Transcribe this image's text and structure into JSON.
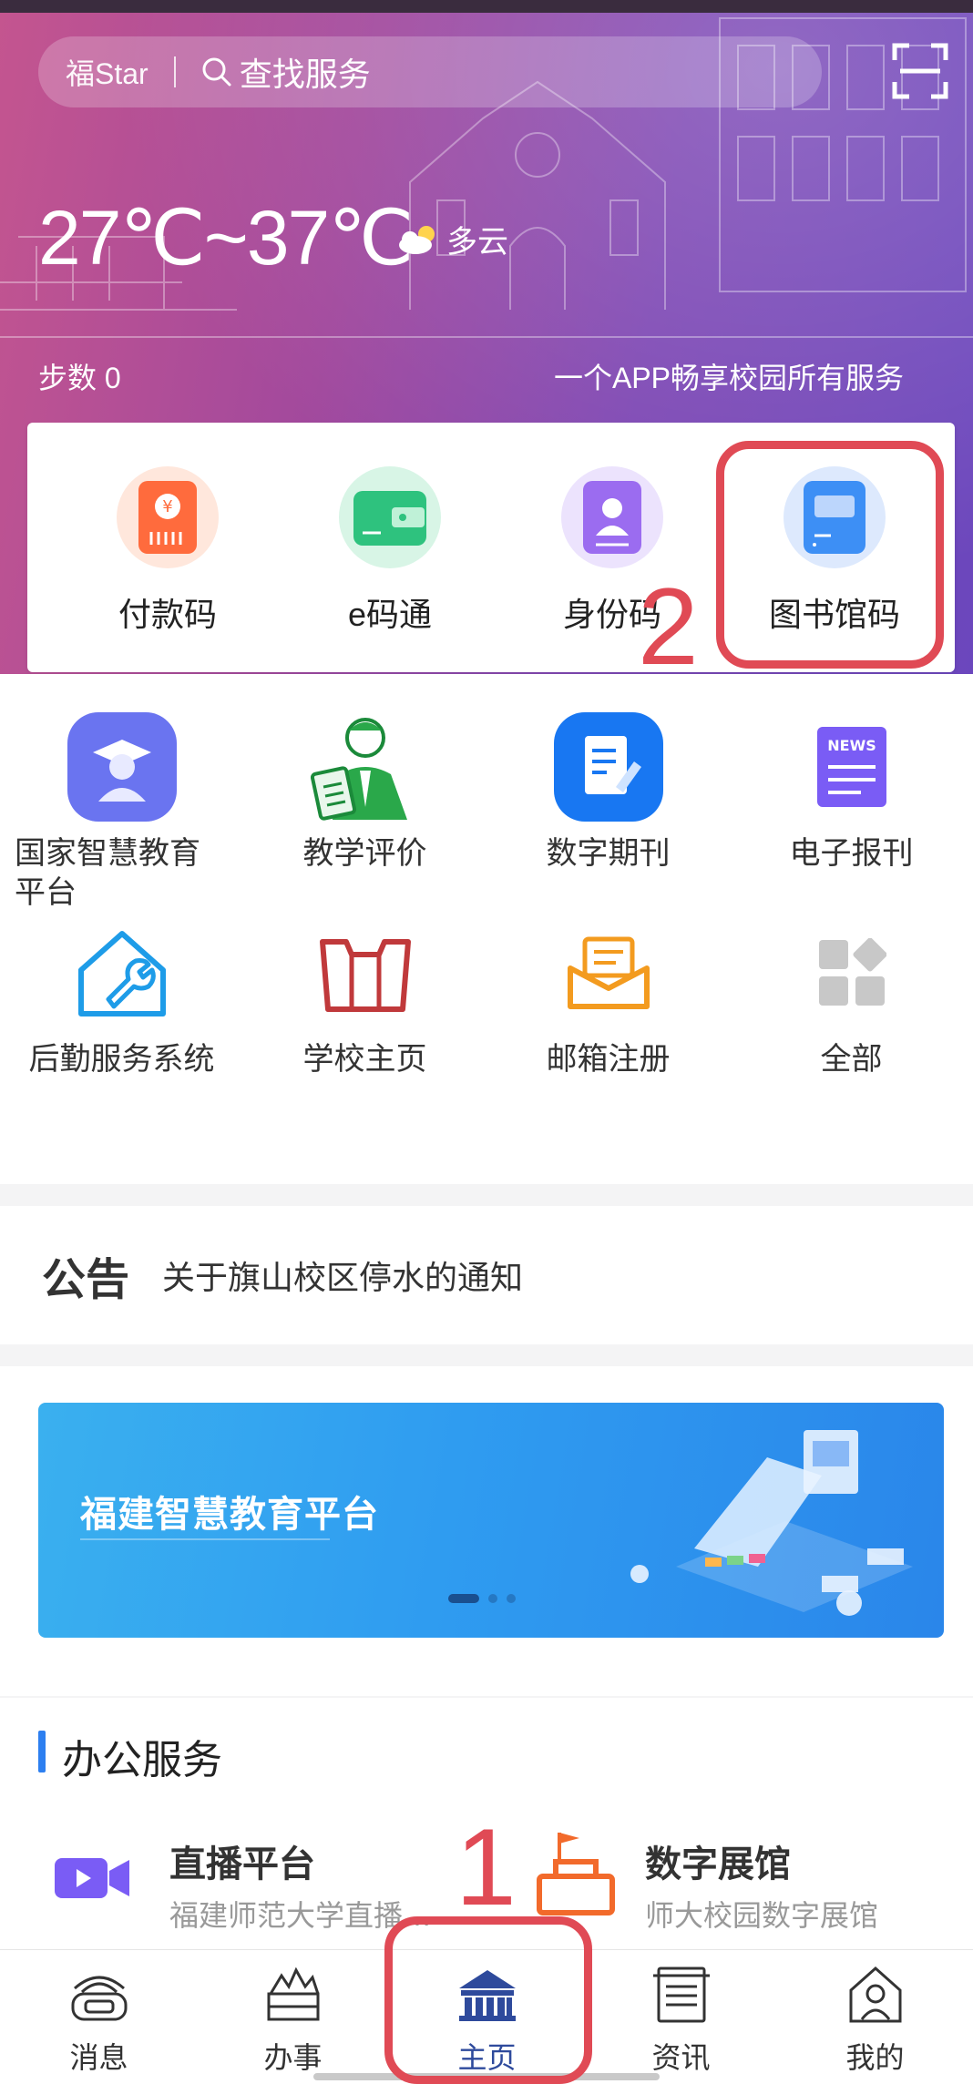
{
  "header": {
    "brand": "福Star",
    "search_placeholder": "查找服务",
    "temperature": "27℃~37℃",
    "weather": "多云",
    "steps": "步数 0",
    "slogan": "一个APP畅享校园所有服务"
  },
  "quick_codes": [
    {
      "label": "付款码",
      "icon": "payment-code-icon",
      "color": "#ff6b3d"
    },
    {
      "label": "e码通",
      "icon": "wallet-icon",
      "color": "#2ec27e"
    },
    {
      "label": "身份码",
      "icon": "id-card-icon",
      "color": "#9b6cf0"
    },
    {
      "label": "图书馆码",
      "icon": "library-card-icon",
      "color": "#3d8ff5"
    }
  ],
  "apps": [
    {
      "label": "国家智慧教育\n平台",
      "icon": "graduate-icon"
    },
    {
      "label": "教学评价",
      "icon": "teacher-evaluation-icon"
    },
    {
      "label": "数字期刊",
      "icon": "digital-journal-icon"
    },
    {
      "label": "电子报刊",
      "icon": "news-icon"
    },
    {
      "label": "后勤服务系统",
      "icon": "logistics-house-icon"
    },
    {
      "label": "学校主页",
      "icon": "school-homepage-icon"
    },
    {
      "label": "邮箱注册",
      "icon": "mail-register-icon"
    },
    {
      "label": "全部",
      "icon": "all-apps-icon"
    }
  ],
  "notice": {
    "title": "公告",
    "text": "关于旗山校区停水的通知"
  },
  "banner": {
    "text": "福建智慧教育平台",
    "active_dot": 0
  },
  "office": {
    "title": "办公服务",
    "services": [
      {
        "title": "直播平台",
        "desc": "福建师范大学直播…",
        "icon": "video-camera-icon"
      },
      {
        "title": "数字展馆",
        "desc": "师大校园数字展馆",
        "icon": "exhibition-hall-icon"
      }
    ]
  },
  "nav": [
    {
      "label": "消息",
      "icon": "message-icon"
    },
    {
      "label": "办事",
      "icon": "affairs-icon"
    },
    {
      "label": "主页",
      "icon": "home-icon",
      "active": true
    },
    {
      "label": "资讯",
      "icon": "news-list-icon"
    },
    {
      "label": "我的",
      "icon": "profile-icon"
    }
  ],
  "annotations": {
    "step1": "1",
    "step2": "2"
  },
  "colors": {
    "accent_red": "#e04a55",
    "nav_active": "#2e4a9c",
    "section_bar": "#2d7ff0"
  }
}
